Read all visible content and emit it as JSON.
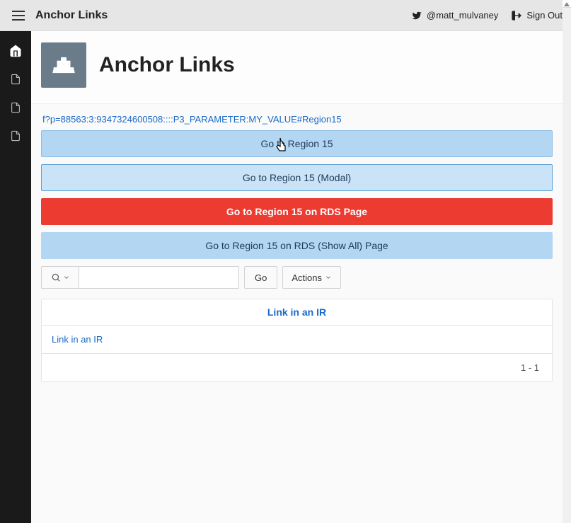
{
  "topbar": {
    "title": "Anchor Links",
    "twitter_handle": "@matt_mulvaney",
    "signout_label": "Sign Out"
  },
  "hero": {
    "title": "Anchor Links"
  },
  "url_text": "f?p=88563:3:9347324600508::::P3_PARAMETER:MY_VALUE#Region15",
  "buttons": {
    "region15": "Go to Region 15",
    "region15_modal": "Go to Region 15 (Modal)",
    "region15_rds": "Go to Region 15 on RDS Page",
    "region15_rds_showall": "Go to Region 15 on RDS (Show All) Page"
  },
  "report": {
    "go_label": "Go",
    "actions_label": "Actions",
    "header": "Link in an IR",
    "row_text": "Link in an IR",
    "pagination": "1 - 1"
  }
}
